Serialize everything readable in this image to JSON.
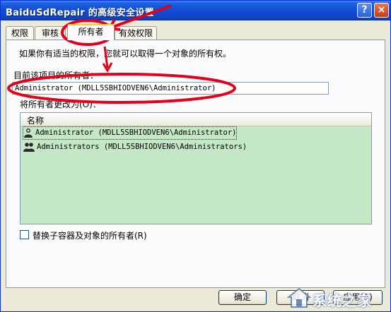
{
  "window": {
    "title": "BaiduSdRepair 的高级安全设置",
    "help_label": "?",
    "close_label": "×"
  },
  "tabs": [
    {
      "label": "权限",
      "active": false
    },
    {
      "label": "审核",
      "active": false
    },
    {
      "label": "所有者",
      "active": true
    },
    {
      "label": "有效权限",
      "active": false
    }
  ],
  "owner_tab": {
    "description": "如果你有适当的权限，您就可以取得一个对象的所有权。",
    "current_owner_label": "目前该项目的所有者：",
    "current_owner_value": "Administrator (MDLL5SBHIODVEN6\\Administrator)",
    "change_owner_label": "将所有者更改为(O)：",
    "list_header": "名称",
    "owners": [
      {
        "name": "Administrator (MDLL5SBHIODVEN6\\Administrator)",
        "icon": "user-icon",
        "selected": true
      },
      {
        "name": "Administrators (MDLL5SBHIODVEN6\\Administrators)",
        "icon": "group-icon",
        "selected": false
      }
    ],
    "replace_owner_label": "替换子容器及对象的所有者(R)",
    "replace_owner_checked": false
  },
  "buttons": {
    "ok": "确定",
    "cancel": "取消",
    "apply": "应用(A)"
  },
  "watermark": {
    "text": "系统之家",
    "icon": "house-logo-icon"
  },
  "colors": {
    "titlebar": "#1450d6",
    "dialog_bg": "#ece9d8",
    "list_bg": "#c4e8c6",
    "annotation": "#e3001b"
  }
}
